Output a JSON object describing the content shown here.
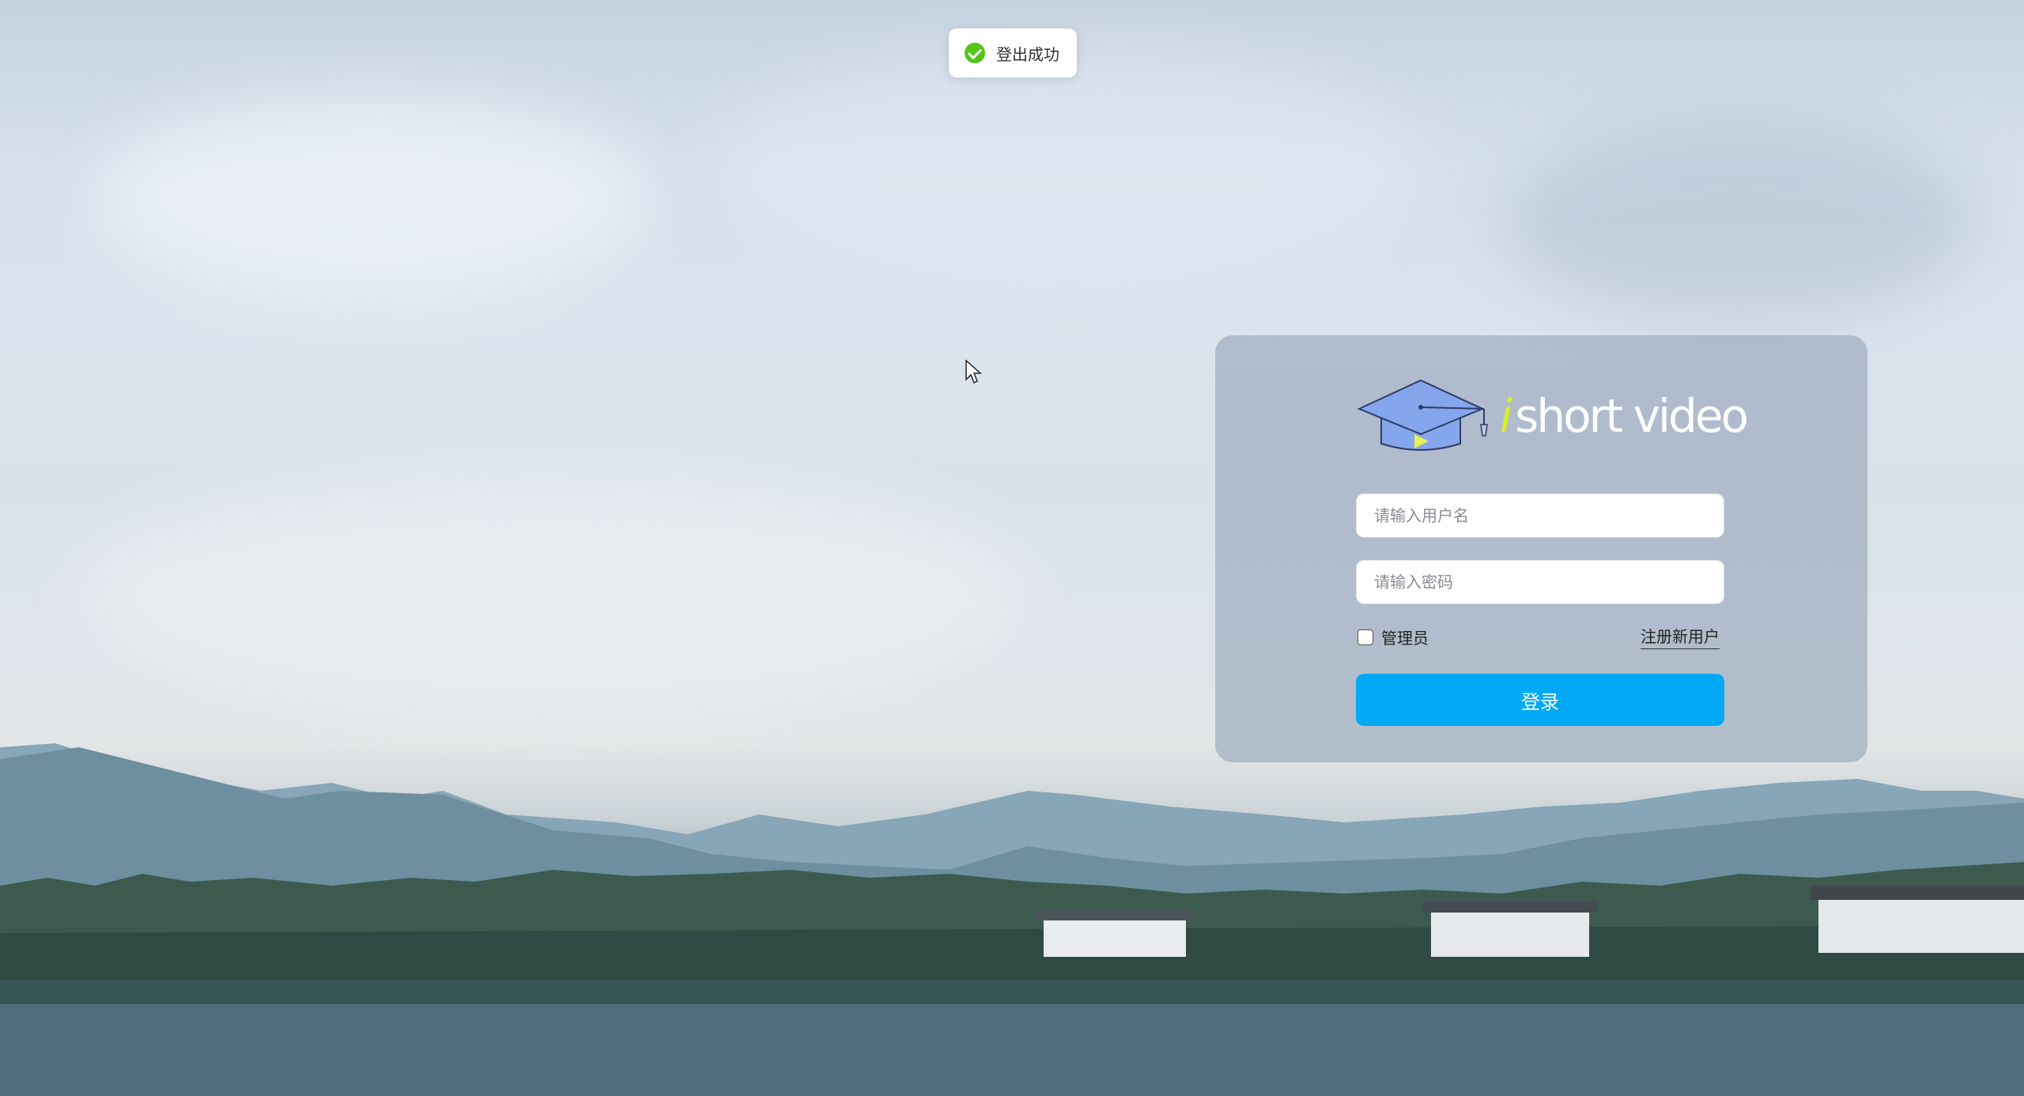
{
  "toast": {
    "icon": "check-circle-icon",
    "message": "登出成功",
    "color": "#52c41a"
  },
  "logo": {
    "icon": "graduation-cap-play-icon",
    "accent_letter": "i",
    "text": "short video",
    "accent_color": "#d8ee23"
  },
  "form": {
    "username_placeholder": "请输入用户名",
    "password_placeholder": "请输入密码",
    "admin_label": "管理员",
    "admin_checked": false,
    "register_link": "注册新用户",
    "login_button": "登录",
    "button_color": "#03a9f4"
  }
}
